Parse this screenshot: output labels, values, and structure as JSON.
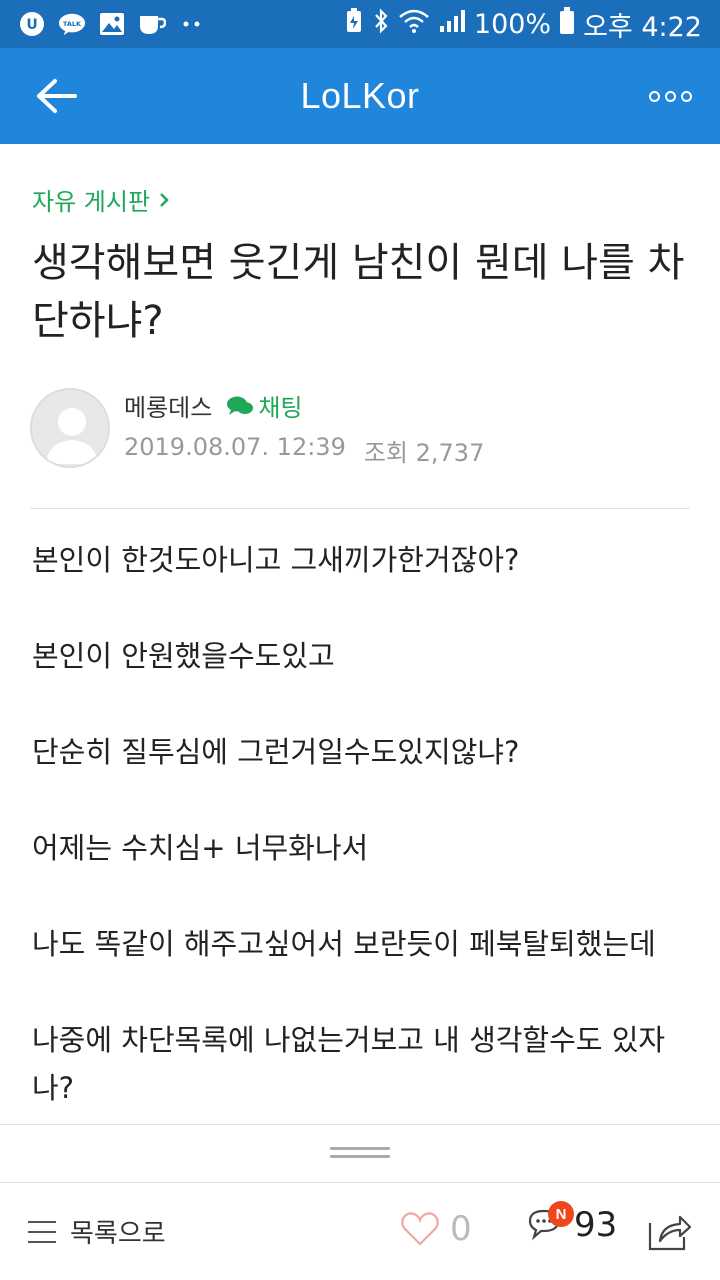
{
  "status_bar": {
    "battery_percent": "100%",
    "time": "오후 4:22",
    "left_icons": [
      "u-plus-icon",
      "kakaotalk-icon",
      "gallery-icon",
      "cup-icon",
      "more-dots-icon"
    ],
    "kakao_label": "TALK"
  },
  "appbar": {
    "title": "LoLKor"
  },
  "post": {
    "board": "자유 게시판",
    "title": "생각해보면 웃긴게 남친이 뭔데 나를 차단하냐?",
    "author": "메롱데스",
    "chat_label": "채팅",
    "date": "2019.08.07. 12:39",
    "views": "조회 2,737",
    "paragraphs": [
      "본인이 한것도아니고 그새끼가한거잖아?",
      "본인이 안원했을수도있고",
      "단순히 질투심에 그런거일수도있지않냐?",
      "어제는 수치심+ 너무화나서",
      "나도 똑같이 해주고싶어서 보란듯이 페북탈퇴했는데",
      "나중에 차단목록에 나없는거보고 내 생각할수도 있자나?"
    ]
  },
  "bottom_bar": {
    "list_label": "목록으로",
    "like_count": "0",
    "comment_count": "93",
    "comment_badge": "N"
  },
  "colors": {
    "status_bar": "#1b6fba",
    "app_bar": "#1f86dc",
    "accent_green": "#1fa857",
    "badge_red": "#f0461e"
  }
}
